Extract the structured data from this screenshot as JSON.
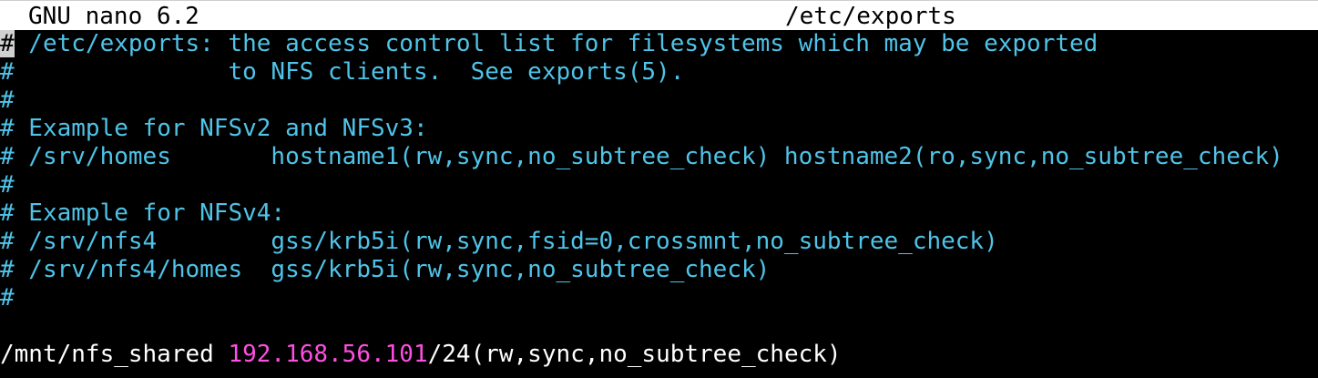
{
  "title_bar": {
    "app_name": "GNU nano 6.2",
    "file_name": "/etc/exports"
  },
  "colors": {
    "background": "#000000",
    "comment": "#4fc3e8",
    "ip_address": "#ff4fe1",
    "title_bg": "#ffffff",
    "cursor_bg": "#d0d0d0"
  },
  "lines": [
    {
      "hash": "#",
      "text": " /etc/exports: the access control list for filesystems which may be exported"
    },
    {
      "hash": "#",
      "text": "               to NFS clients.  See exports(5)."
    },
    {
      "hash": "#",
      "text": ""
    },
    {
      "hash": "#",
      "text": " Example for NFSv2 and NFSv3:"
    },
    {
      "hash": "#",
      "text": " /srv/homes       hostname1(rw,sync,no_subtree_check) hostname2(ro,sync,no_subtree_check)"
    },
    {
      "hash": "#",
      "text": ""
    },
    {
      "hash": "#",
      "text": " Example for NFSv4:"
    },
    {
      "hash": "#",
      "text": " /srv/nfs4        gss/krb5i(rw,sync,fsid=0,crossmnt,no_subtree_check)"
    },
    {
      "hash": "#",
      "text": " /srv/nfs4/homes  gss/krb5i(rw,sync,no_subtree_check)"
    },
    {
      "hash": "#",
      "text": ""
    }
  ],
  "export_line": {
    "path": "/mnt/nfs_shared ",
    "ip": "192.168.56.101",
    "options": "/24(rw,sync,no_subtree_check)"
  }
}
